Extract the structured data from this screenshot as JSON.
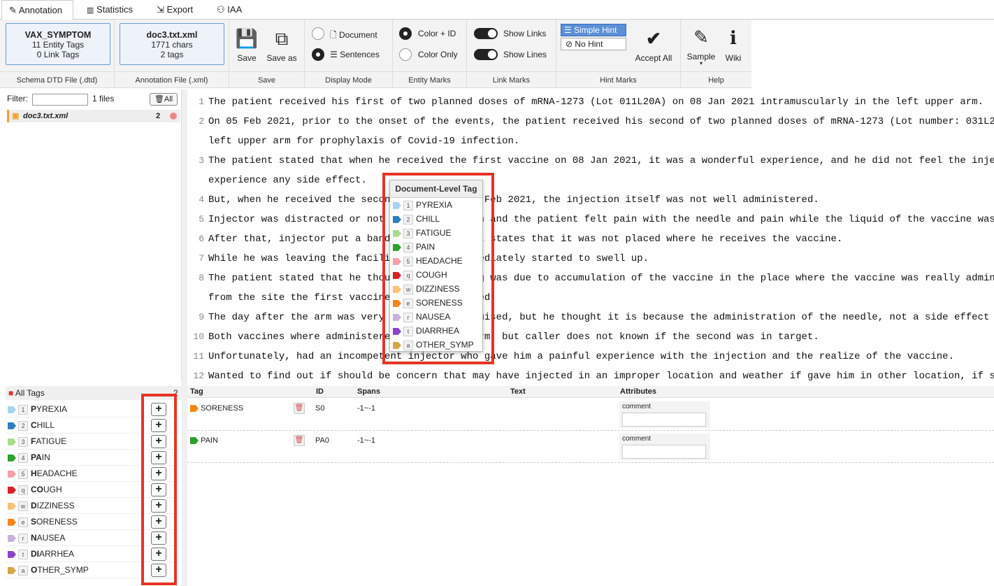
{
  "tabs": [
    {
      "label": "Annotation",
      "icon": "pen-icon"
    },
    {
      "label": "Statistics",
      "icon": "chart-icon"
    },
    {
      "label": "Export",
      "icon": "export-icon"
    },
    {
      "label": "IAA",
      "icon": "people-icon"
    }
  ],
  "ribbon": {
    "schema": {
      "name": "VAX_SYMPTOM",
      "entity_tags": "11 Entity Tags",
      "link_tags": "0 Link Tags",
      "footer": "Schema DTD File (.dtd)"
    },
    "annotation": {
      "name": "doc3.txt.xml",
      "chars": "1771 chars",
      "tags": "2 tags",
      "footer": "Annotation File (.xml)"
    },
    "save": {
      "save": "Save",
      "save_as": "Save as",
      "footer": "Save"
    },
    "display": {
      "document": "Document",
      "sentences": "Sentences",
      "footer": "Display Mode"
    },
    "entity": {
      "color_id": "Color + ID",
      "color_only": "Color Only",
      "footer": "Entity Marks"
    },
    "link": {
      "show_links": "Show Links",
      "show_lines": "Show Lines",
      "footer": "Link Marks"
    },
    "hint": {
      "simple": "Simple Hint",
      "no_hint": "No Hint",
      "accept_all": "Accept All",
      "footer": "Hint Marks"
    },
    "help": {
      "sample": "Sample",
      "wiki": "Wiki",
      "footer": "Help"
    }
  },
  "sidebar": {
    "filter_label": "Filter:",
    "file_count": "1 files",
    "all_button": "All",
    "file": {
      "name": "doc3.txt.xml",
      "count": "2"
    }
  },
  "editor": {
    "lines": [
      {
        "n": "1",
        "text": "The patient received his first of two planned doses of mRNA-1273 (Lot 011L20A) on 08 Jan 2021 intramuscularly in the left upper arm."
      },
      {
        "n": "2",
        "text": "On 05 Feb 2021, prior to the onset of the events, the patient received his second of two planned doses of mRNA-1273 (Lot number: 031L2"
      },
      {
        "n": "",
        "text": "left upper arm for prophylaxis of Covid-19 infection."
      },
      {
        "n": "3",
        "text": "The patient stated that when he received the first vaccine on 08 Jan 2021, it was a wonderful experience, and he did not feel the inje"
      },
      {
        "n": "",
        "text": "experience any side effect."
      },
      {
        "n": "4",
        "text": "But, when he received the second vaccine on 05 Feb 2021, the injection itself was not well administered."
      },
      {
        "n": "5",
        "text": "Injector was distracted or not paying attention and the patient felt pain with the needle and pain while the liquid of the vaccine was e"
      },
      {
        "n": "6",
        "text": "After that, injector put a band-aid and patient states that it was not placed where he receives the vaccine."
      },
      {
        "n": "7",
        "text": "While he was leaving the facility, the arm immediately started to swell up."
      },
      {
        "n": "8",
        "text": "The patient stated that he thought the swelling was due to accumulation of the vaccine in the place where the vaccine was really admin"
      },
      {
        "n": "",
        "text": "from the site the first vaccine was administered."
      },
      {
        "n": "9",
        "text": "The day after the arm was very sore and was bruised, but he thought it is because the administration of the needle, not a side effect"
      },
      {
        "n": "10",
        "text": "Both vaccines where administered in the left arm, but caller does not known if the second was in target."
      },
      {
        "n": "11",
        "text": "Unfortunately, had an incompetent injector who gave him a painful experience with the injection and the realize of the vaccine."
      },
      {
        "n": "12",
        "text": "Wanted to find out if should be concern that may have injected in an improper location and weather if gave him in other location, if s"
      }
    ]
  },
  "popup": {
    "title": "Document-Level Tag"
  },
  "tags": [
    {
      "key": "1",
      "name": "PYREXIA",
      "bold": "P",
      "rest": "YREXIA",
      "color": "#a8d4ec"
    },
    {
      "key": "2",
      "name": "CHILL",
      "bold": "C",
      "rest": "HILL",
      "color": "#2f7cbf"
    },
    {
      "key": "3",
      "name": "FATIGUE",
      "bold": "F",
      "rest": "ATIGUE",
      "color": "#a9dc8f"
    },
    {
      "key": "4",
      "name": "PAIN",
      "bold": "PA",
      "rest": "IN",
      "color": "#2ea02e"
    },
    {
      "key": "5",
      "name": "HEADACHE",
      "bold": "H",
      "rest": "EADACHE",
      "color": "#f5a0a8"
    },
    {
      "key": "q",
      "name": "COUGH",
      "bold": "CO",
      "rest": "UGH",
      "color": "#d92025"
    },
    {
      "key": "w",
      "name": "DIZZINESS",
      "bold": "D",
      "rest": "IZZINESS",
      "color": "#fbc27a"
    },
    {
      "key": "e",
      "name": "SORENESS",
      "bold": "S",
      "rest": "ORENESS",
      "color": "#f7841a"
    },
    {
      "key": "r",
      "name": "NAUSEA",
      "bold": "N",
      "rest": "AUSEA",
      "color": "#c8b2dc"
    },
    {
      "key": "t",
      "name": "DIARRHEA",
      "bold": "DI",
      "rest": "ARRHEA",
      "color": "#8a44c8"
    },
    {
      "key": "a",
      "name": "OTHER_SYMP",
      "bold": "O",
      "rest": "THER_SYMP",
      "color": "#d3a848"
    }
  ],
  "tag_panel": {
    "title": "All Tags",
    "count": "2"
  },
  "table": {
    "headers": {
      "tag": "Tag",
      "id": "ID",
      "spans": "Spans",
      "text": "Text",
      "attributes": "Attributes"
    },
    "rows": [
      {
        "tag": "SORENESS",
        "color": "#f7841a",
        "id": "S0",
        "spans": "-1~-1",
        "text": "",
        "attr_label": "comment"
      },
      {
        "tag": "PAIN",
        "color": "#2ea02e",
        "id": "PA0",
        "spans": "-1~-1",
        "text": "",
        "attr_label": "comment"
      }
    ]
  },
  "colors": {
    "highlight": "#e53525",
    "selected_hint": "#5b8fd6"
  }
}
